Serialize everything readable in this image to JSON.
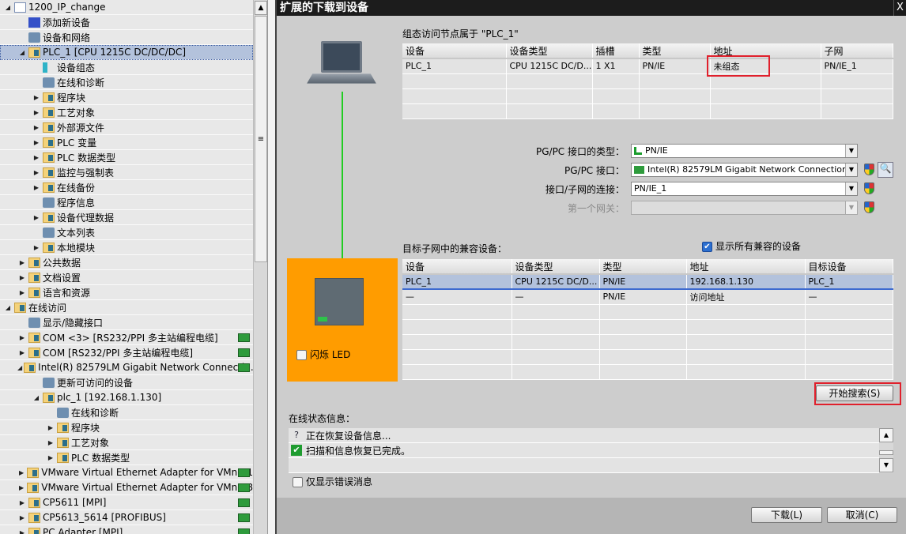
{
  "tree": [
    {
      "label": "1200_IP_change",
      "level": 0,
      "exp": "open",
      "icon": "document-icon"
    },
    {
      "label": "添加新设备",
      "level": 1,
      "exp": "",
      "icon": "add-device-icon"
    },
    {
      "label": "设备和网络",
      "level": 1,
      "exp": "",
      "icon": "network-icon"
    },
    {
      "label": "PLC_1 [CPU 1215C DC/DC/DC]",
      "level": 1,
      "exp": "open",
      "icon": "plc-folder-icon",
      "selected": true
    },
    {
      "label": "设备组态",
      "level": 2,
      "exp": "",
      "icon": "device-config-icon"
    },
    {
      "label": "在线和诊断",
      "level": 2,
      "exp": "",
      "icon": "diagnostics-icon"
    },
    {
      "label": "程序块",
      "level": 2,
      "exp": "closed",
      "icon": "folder-icon"
    },
    {
      "label": "工艺对象",
      "level": 2,
      "exp": "closed",
      "icon": "folder-icon"
    },
    {
      "label": "外部源文件",
      "level": 2,
      "exp": "closed",
      "icon": "folder-icon"
    },
    {
      "label": "PLC 变量",
      "level": 2,
      "exp": "closed",
      "icon": "folder-icon"
    },
    {
      "label": "PLC 数据类型",
      "level": 2,
      "exp": "closed",
      "icon": "folder-icon"
    },
    {
      "label": "监控与强制表",
      "level": 2,
      "exp": "closed",
      "icon": "folder-icon"
    },
    {
      "label": "在线备份",
      "level": 2,
      "exp": "closed",
      "icon": "folder-icon"
    },
    {
      "label": "程序信息",
      "level": 2,
      "exp": "",
      "icon": "program-info-icon"
    },
    {
      "label": "设备代理数据",
      "level": 2,
      "exp": "closed",
      "icon": "folder-icon"
    },
    {
      "label": "文本列表",
      "level": 2,
      "exp": "",
      "icon": "text-list-icon"
    },
    {
      "label": "本地模块",
      "level": 2,
      "exp": "closed",
      "icon": "folder-icon"
    },
    {
      "label": "公共数据",
      "level": 1,
      "exp": "closed",
      "icon": "folder-icon"
    },
    {
      "label": "文档设置",
      "level": 1,
      "exp": "closed",
      "icon": "folder-icon"
    },
    {
      "label": "语言和资源",
      "level": 1,
      "exp": "closed",
      "icon": "folder-icon"
    },
    {
      "label": "在线访问",
      "level": 0,
      "exp": "open",
      "icon": "folder-icon"
    },
    {
      "label": "显示/隐藏接口",
      "level": 1,
      "exp": "",
      "icon": "wrench-icon"
    },
    {
      "label": "COM <3> [RS232/PPI 多主站编程电缆]",
      "level": 1,
      "exp": "closed",
      "icon": "folder-icon",
      "nic": true
    },
    {
      "label": "COM [RS232/PPI 多主站编程电缆]",
      "level": 1,
      "exp": "closed",
      "icon": "folder-icon",
      "nic": true
    },
    {
      "label": "Intel(R) 82579LM Gigabit Network Connecti...",
      "level": 1,
      "exp": "open",
      "icon": "folder-icon",
      "nic": true
    },
    {
      "label": "更新可访问的设备",
      "level": 2,
      "exp": "",
      "icon": "update-devices-icon"
    },
    {
      "label": "plc_1 [192.168.1.130]",
      "level": 2,
      "exp": "open",
      "icon": "plc-folder-icon"
    },
    {
      "label": "在线和诊断",
      "level": 3,
      "exp": "",
      "icon": "diagnostics-icon"
    },
    {
      "label": "程序块",
      "level": 3,
      "exp": "closed",
      "icon": "folder-icon"
    },
    {
      "label": "工艺对象",
      "level": 3,
      "exp": "closed",
      "icon": "folder-icon"
    },
    {
      "label": "PLC 数据类型",
      "level": 3,
      "exp": "closed",
      "icon": "folder-icon"
    },
    {
      "label": "VMware Virtual Ethernet Adapter for VMnet1",
      "level": 1,
      "exp": "closed",
      "icon": "folder-icon",
      "nic": true
    },
    {
      "label": "VMware Virtual Ethernet Adapter for VMnet8",
      "level": 1,
      "exp": "closed",
      "icon": "folder-icon",
      "nic": true
    },
    {
      "label": "CP5611 [MPI]",
      "level": 1,
      "exp": "closed",
      "icon": "folder-icon",
      "nic": true
    },
    {
      "label": "CP5613_5614 [PROFIBUS]",
      "level": 1,
      "exp": "closed",
      "icon": "folder-icon",
      "nic": true
    },
    {
      "label": "PC Adapter [MPI]",
      "level": 1,
      "exp": "closed",
      "icon": "folder-icon",
      "nic": true
    }
  ],
  "dialog": {
    "title": "扩展的下载到设备",
    "close": "X",
    "config_label": "组态访问节点属于 \"PLC_1\"",
    "config_headers": [
      "设备",
      "设备类型",
      "插槽",
      "类型",
      "地址",
      "子网"
    ],
    "config_rows": [
      [
        "PLC_1",
        "CPU 1215C DC/D...",
        "1 X1",
        "PN/IE",
        "未组态",
        "PN/IE_1"
      ],
      [
        "",
        "",
        "",
        "",
        "",
        ""
      ],
      [
        "",
        "",
        "",
        "",
        "",
        ""
      ],
      [
        "",
        "",
        "",
        "",
        "",
        ""
      ]
    ],
    "form": {
      "type_label": "PG/PC 接口的类型：",
      "type_value": "PN/IE",
      "iface_label": "PG/PC 接口：",
      "iface_value": "Intel(R) 82579LM Gigabit Network Connection",
      "conn_label": "接口/子网的连接：",
      "conn_value": "PN/IE_1",
      "gw_label": "第一个网关：",
      "gw_value": ""
    },
    "compat_label": "目标子网中的兼容设备：",
    "show_all_label": "显示所有兼容的设备",
    "show_all_checked": true,
    "compat_headers": [
      "设备",
      "设备类型",
      "类型",
      "地址",
      "目标设备"
    ],
    "compat_rows": [
      [
        "PLC_1",
        "CPU 1215C DC/D...",
        "PN/IE",
        "192.168.1.130",
        "PLC_1"
      ],
      [
        "—",
        "—",
        "PN/IE",
        "访问地址",
        "—"
      ],
      [
        "",
        "",
        "",
        "",
        ""
      ],
      [
        "",
        "",
        "",
        "",
        ""
      ],
      [
        "",
        "",
        "",
        "",
        ""
      ],
      [
        "",
        "",
        "",
        "",
        ""
      ],
      [
        "",
        "",
        "",
        "",
        ""
      ]
    ],
    "flash_led_label": "闪烁 LED",
    "search_button": "开始搜索(S)",
    "status_label": "在线状态信息：",
    "status_items": [
      {
        "text": "正在恢复设备信息...",
        "icon": "update-devices-icon"
      },
      {
        "text": "扫描和信息恢复已完成。",
        "icon": "check-icon"
      },
      {
        "text": "",
        "icon": ""
      }
    ],
    "errors_only_label": "仅显示错误消息",
    "download_button": "下载(L)",
    "cancel_button": "取消(C)"
  },
  "colors": {
    "title_bar": "#1c1c1c",
    "highlight_box": "#e0202c",
    "plc_panel": "#ff9c00",
    "link_line": "#22cc22",
    "selection": "#b3c2dc"
  }
}
